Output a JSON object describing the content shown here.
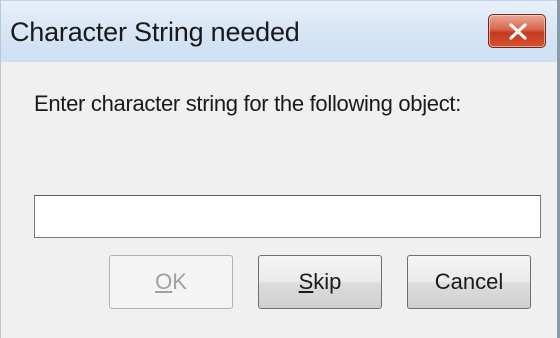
{
  "window": {
    "title": "Character String needed",
    "close_icon": "close-x-icon",
    "close_button_color": "#c4391d"
  },
  "prompt": {
    "label": "Enter character string for the following object:"
  },
  "input": {
    "value": "",
    "placeholder": ""
  },
  "buttons": {
    "ok": {
      "mnemonic": "O",
      "rest": "K",
      "enabled": false
    },
    "skip": {
      "mnemonic": "S",
      "rest": "kip",
      "enabled": true
    },
    "cancel": {
      "label": "Cancel",
      "enabled": true
    }
  }
}
